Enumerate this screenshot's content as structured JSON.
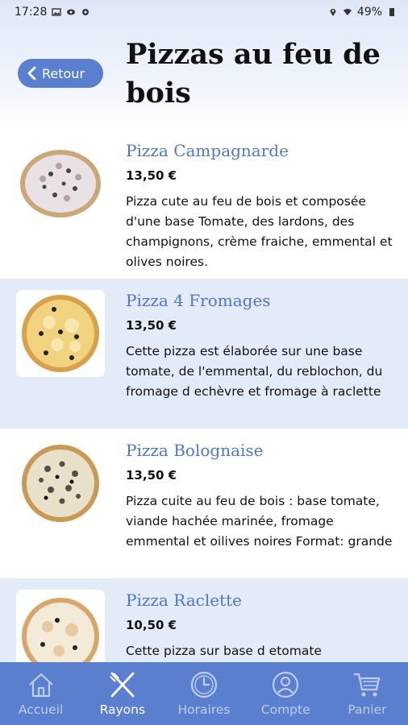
{
  "status_bar": {
    "time": "17:28",
    "battery": "49%"
  },
  "header": {
    "back_label": "Retour",
    "title": "Pizzas au feu de bois"
  },
  "products": [
    {
      "name": "Pizza Campagnarde",
      "price": "13,50 €",
      "description": "Pizza cute au feu de bois et composée d'une base Tomate, des lardons, des champignons, crème fraiche, emmental et olives noires."
    },
    {
      "name": "Pizza 4 Fromages",
      "price": "13,50 €",
      "description": "Cette pizza est élaborée sur une base tomate, de l'emmental, du reblochon, du fromage d echèvre et fromage à raclette"
    },
    {
      "name": "Pizza Bolognaise",
      "price": "13,50 €",
      "description": "Pizza cuite au feu de bois : base tomate, viande hachée marinée, fromage emmental et oilives noires Format: grande"
    },
    {
      "name": "Pizza Raclette",
      "price": "10,50 €",
      "description": "Cette pizza sur base d etomate"
    }
  ],
  "tabbar": {
    "items": [
      {
        "label": "Accueil",
        "icon": "home-icon"
      },
      {
        "label": "Rayons",
        "icon": "utensils-icon"
      },
      {
        "label": "Horaires",
        "icon": "clock-icon"
      },
      {
        "label": "Compte",
        "icon": "user-icon"
      },
      {
        "label": "Panier",
        "icon": "cart-icon"
      }
    ],
    "active": "Rayons"
  },
  "colors": {
    "accent": "#5b7fcf",
    "title_blue": "#4f76c9",
    "alt_row": "#e3eaf8"
  }
}
